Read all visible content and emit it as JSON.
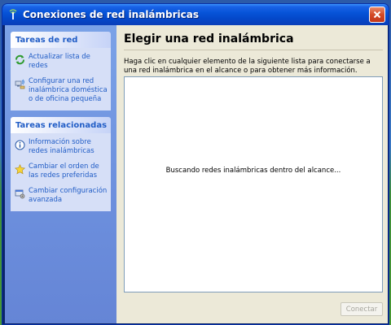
{
  "window": {
    "title": "Conexiones de red inalámbricas"
  },
  "taskpane": {
    "network_tasks": {
      "header": "Tareas de red",
      "items": [
        {
          "label": "Actualizar lista de redes",
          "icon": "refresh-icon"
        },
        {
          "label": "Configurar una red inalámbrica doméstica o de oficina pequeña",
          "icon": "network-setup-icon"
        }
      ]
    },
    "related_tasks": {
      "header": "Tareas relacionadas",
      "items": [
        {
          "label": "Información sobre redes inalámbricas",
          "icon": "info-icon"
        },
        {
          "label": "Cambiar el orden de las redes preferidas",
          "icon": "star-icon"
        },
        {
          "label": "Cambiar configuración avanzada",
          "icon": "settings-icon"
        }
      ]
    }
  },
  "main": {
    "title": "Elegir una red inalámbrica",
    "instructions": "Haga clic en cualquier elemento de la siguiente lista para conectarse a una red inalámbrica en el alcance o para obtener más información.",
    "status": "Buscando redes inalámbricas dentro del alcance...",
    "connect_label": "Conectar"
  },
  "colors": {
    "titlebar": "#0754d8",
    "taskpane": "#6c8fdd",
    "link": "#215dc6",
    "close": "#d44a26"
  }
}
